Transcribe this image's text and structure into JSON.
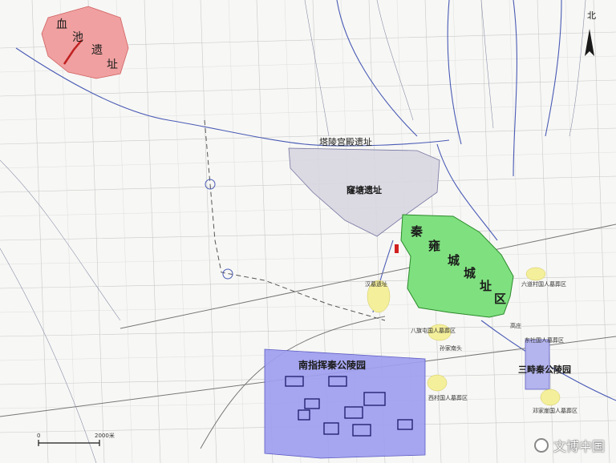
{
  "map": {
    "north_label": "北",
    "scale_bar": {
      "left": "0",
      "right": "2000米"
    },
    "site_labels": {
      "xuechi": [
        "血",
        "池",
        "遗",
        "址"
      ],
      "taling": "塔陵宫殿遗址",
      "yaodi": "窿塘遗址",
      "qinyong": [
        "秦",
        "雍",
        "城",
        "城",
        "址",
        "区"
      ],
      "nanzhihui": "南指挥秦公陵园",
      "sanzhi": "三畤秦公陵园"
    },
    "small_labels": {
      "a": "汉墓遗址",
      "b": "八旗屯国人墓葬区",
      "c": "六道村国人墓葬区",
      "d": "孙家南头",
      "e": "高庄",
      "f": "西村国人墓葬区",
      "g": "东社国人墓葬区",
      "h": "邓家崖国人墓葬区"
    },
    "watermark": "文博中国",
    "colors": {
      "xuechi": "#f0a0a0",
      "yaodi": "#d8d6e0",
      "qinyong": "#7fe07f",
      "lingyuan": "#9f9ff0",
      "cemetery": "#f4ef9a",
      "river": "#4a5bb5",
      "road": "#777777"
    }
  }
}
